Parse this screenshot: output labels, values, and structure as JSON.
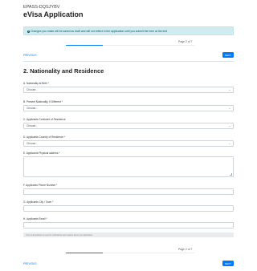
{
  "header": {
    "reference": "EPASS-DQSJYBV",
    "title": "eVisa Application"
  },
  "alert": {
    "icon": "info-icon",
    "icon_glyph": "i",
    "text": "Changes you make will be saved as draft and will not reflect in the application until you submit the form at the end"
  },
  "progress": {
    "page_label": "Page 2 of 7",
    "current_page": 2,
    "total_pages": 7
  },
  "nav": {
    "previous_label": "PREVIOUS",
    "next_label": "NEXT"
  },
  "section": {
    "title": "2. Nationality and Residence"
  },
  "fields": {
    "nationality_at_birth": {
      "label": "A. Nationality at Birth *",
      "value": "Choose...",
      "type": "select"
    },
    "present_nationality": {
      "label": "B. Present Nationality, If Different *",
      "value": "Choose...",
      "type": "select"
    },
    "continent_of_residence": {
      "label": "C. Applicants Continent of Residence",
      "value": "Choose...",
      "type": "select"
    },
    "country_of_residence": {
      "label": "D. Applicants Country of Residence *",
      "value": "Choose...",
      "type": "select"
    },
    "physical_address": {
      "label": "E. Applicants Physical address *",
      "value": "",
      "type": "textarea"
    },
    "phone_number": {
      "label": "F. Applicants Phone Number *",
      "value": "",
      "type": "text"
    },
    "city_town": {
      "label": "G. Applicants City / Town *",
      "value": "",
      "type": "text"
    },
    "email": {
      "label": "H. Applicants Email *",
      "value": "",
      "type": "text"
    }
  },
  "footer_note": "Your email address is used for notifications and updates about your application",
  "colors": {
    "primary": "#007bff",
    "alert_bg": "#d1ecf1",
    "alert_text": "#0c5460"
  }
}
